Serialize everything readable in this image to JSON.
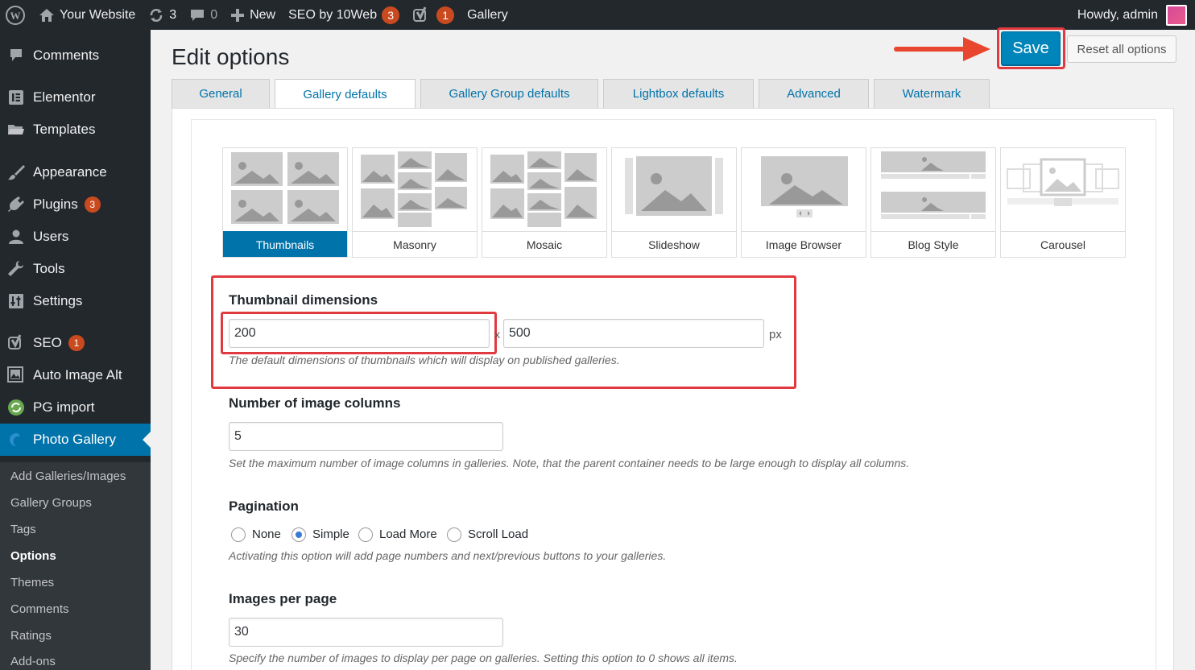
{
  "adminbar": {
    "site_name": "Your Website",
    "updates_count": "3",
    "comments_count": "0",
    "new_label": "New",
    "seo_label": "SEO by 10Web",
    "seo_badge": "3",
    "yoast_badge": "1",
    "gallery_label": "Gallery",
    "howdy": "Howdy, admin"
  },
  "sidebar": {
    "items": [
      {
        "label": "Comments",
        "icon": "comment-icon"
      },
      {
        "label": "Elementor",
        "icon": "elementor-icon"
      },
      {
        "label": "Templates",
        "icon": "folder-icon"
      },
      {
        "label": "Appearance",
        "icon": "paintbrush-icon"
      },
      {
        "label": "Plugins",
        "icon": "plugin-icon",
        "badge": "3"
      },
      {
        "label": "Users",
        "icon": "users-icon"
      },
      {
        "label": "Tools",
        "icon": "wrench-icon"
      },
      {
        "label": "Settings",
        "icon": "settings-icon"
      },
      {
        "label": "SEO",
        "icon": "yoast-icon",
        "badge": "1"
      },
      {
        "label": "Auto Image Alt",
        "icon": "image-icon"
      },
      {
        "label": "PG import",
        "icon": "recycle-icon"
      },
      {
        "label": "Photo Gallery",
        "icon": "photo-gallery-icon"
      }
    ],
    "submenu": [
      "Add Galleries/Images",
      "Gallery Groups",
      "Tags",
      "Options",
      "Themes",
      "Comments",
      "Ratings",
      "Add-ons"
    ],
    "active_submenu": "Options"
  },
  "page": {
    "title": "Edit options",
    "save_label": "Save",
    "reset_label": "Reset all options"
  },
  "tabs": [
    "General",
    "Gallery defaults",
    "Gallery Group defaults",
    "Lightbox defaults",
    "Advanced",
    "Watermark"
  ],
  "active_tab": "Gallery defaults",
  "views": [
    "Thumbnails",
    "Masonry",
    "Mosaic",
    "Slideshow",
    "Image Browser",
    "Blog Style",
    "Carousel"
  ],
  "active_view": "Thumbnails",
  "thumbnail_dimensions": {
    "title": "Thumbnail dimensions",
    "width": "200",
    "separator": "x",
    "height": "500",
    "unit": "px",
    "description": "The default dimensions of thumbnails which will display on published galleries."
  },
  "image_columns": {
    "title": "Number of image columns",
    "value": "5",
    "description": "Set the maximum number of image columns in galleries. Note, that the parent container needs to be large enough to display all columns."
  },
  "pagination": {
    "title": "Pagination",
    "options": [
      "None",
      "Simple",
      "Load More",
      "Scroll Load"
    ],
    "selected": "Simple",
    "description": "Activating this option will add page numbers and next/previous buttons to your galleries."
  },
  "images_per_page": {
    "title": "Images per page",
    "value": "30",
    "description": "Specify the number of images to display per page on galleries. Setting this option to 0 shows all items."
  },
  "colors": {
    "admin_dark": "#23282d",
    "accent_blue": "#0073aa",
    "save_blue": "#0085ba",
    "highlight_red": "#e0393e",
    "badge_orange": "#ca4a1f"
  }
}
